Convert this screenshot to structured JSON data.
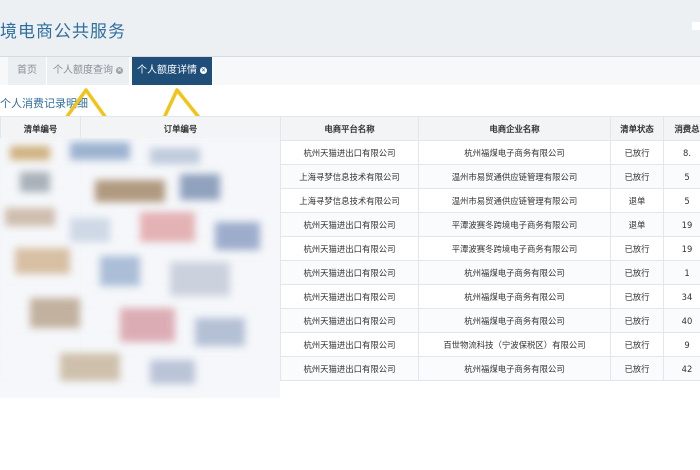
{
  "header": {
    "title": "境电商公共服务"
  },
  "tabs": [
    {
      "label": "首页",
      "closable": false,
      "active": false
    },
    {
      "label": "个人额度查询",
      "closable": true,
      "active": false
    },
    {
      "label": "个人额度详情",
      "closable": true,
      "active": true
    }
  ],
  "section": {
    "title": "个人消费记录明细"
  },
  "table": {
    "columns": [
      "清单编号",
      "订单编号",
      "电商平台名称",
      "电商企业名称",
      "清单状态",
      "消费总"
    ],
    "rows": [
      {
        "platform": "杭州天猫进出口有限公司",
        "enterprise": "杭州福煤电子商务有限公司",
        "status": "已放行",
        "amount": "8."
      },
      {
        "platform": "上海寻梦信息技术有限公司",
        "enterprise": "温州市易贸通供应链管理有限公司",
        "status": "已放行",
        "amount": "5"
      },
      {
        "platform": "上海寻梦信息技术有限公司",
        "enterprise": "温州市易贸通供应链管理有限公司",
        "status": "退单",
        "amount": "5"
      },
      {
        "platform": "杭州天猫进出口有限公司",
        "enterprise": "平潭波赛冬跨境电子商务有限公司",
        "status": "退单",
        "amount": "19"
      },
      {
        "platform": "杭州天猫进出口有限公司",
        "enterprise": "平潭波赛冬跨境电子商务有限公司",
        "status": "已放行",
        "amount": "19"
      },
      {
        "platform": "杭州天猫进出口有限公司",
        "enterprise": "杭州福煤电子商务有限公司",
        "status": "已放行",
        "amount": "1"
      },
      {
        "platform": "杭州天猫进出口有限公司",
        "enterprise": "杭州福煤电子商务有限公司",
        "status": "已放行",
        "amount": "34"
      },
      {
        "platform": "杭州天猫进出口有限公司",
        "enterprise": "杭州福煤电子商务有限公司",
        "status": "已放行",
        "amount": "40"
      },
      {
        "platform": "杭州天猫进出口有限公司",
        "enterprise": "百世物流科技（宁波保税区）有限公司",
        "status": "已放行",
        "amount": "9"
      },
      {
        "platform": "杭州天猫进出口有限公司",
        "enterprise": "杭州福煤电子商务有限公司",
        "status": "已放行",
        "amount": "42"
      }
    ]
  },
  "colors": {
    "accent": "#2f6f9f",
    "active_tab": "#1f4e79",
    "annotation": "#f0c419"
  },
  "icons": {
    "tab_close": "close-icon",
    "annotation": "triangle-arrow-icon"
  }
}
